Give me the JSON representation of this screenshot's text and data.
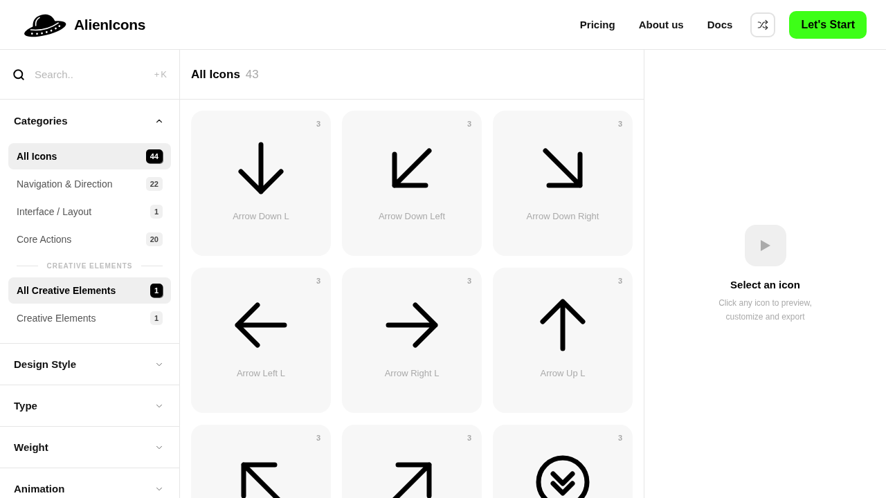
{
  "header": {
    "brand": "AlienIcons",
    "nav": [
      "Pricing",
      "About us",
      "Docs"
    ],
    "cta": "Let's Start"
  },
  "sidebar": {
    "search": {
      "placeholder": "Search..",
      "shortcut": "+K"
    },
    "sections": [
      {
        "title": "Categories",
        "expanded": true,
        "groups": [
          {
            "items": [
              {
                "label": "All Icons",
                "count": "44",
                "selected": true
              },
              {
                "label": "Navigation & Direction",
                "count": "22",
                "selected": false
              },
              {
                "label": "Interface / Layout",
                "count": "1",
                "selected": false
              },
              {
                "label": "Core Actions",
                "count": "20",
                "selected": false
              }
            ]
          },
          {
            "label": "CREATIVE ELEMENTS",
            "items": [
              {
                "label": "All Creative Elements",
                "count": "1",
                "selected": true
              },
              {
                "label": "Creative Elements",
                "count": "1",
                "selected": false
              }
            ]
          }
        ]
      },
      {
        "title": "Design Style",
        "expanded": false
      },
      {
        "title": "Type",
        "expanded": false
      },
      {
        "title": "Weight",
        "expanded": false
      },
      {
        "title": "Animation",
        "expanded": false
      }
    ]
  },
  "main": {
    "title": "All Icons",
    "count": "43",
    "cards": [
      {
        "kind": "down",
        "name": "Arrow Down L",
        "count": "3"
      },
      {
        "kind": "down-left",
        "name": "Arrow Down Left",
        "count": "3"
      },
      {
        "kind": "down-right",
        "name": "Arrow Down Right",
        "count": "3"
      },
      {
        "kind": "left",
        "name": "Arrow Left L",
        "count": "3"
      },
      {
        "kind": "right",
        "name": "Arrow Right L",
        "count": "3"
      },
      {
        "kind": "up",
        "name": "Arrow Up L",
        "count": "3"
      },
      {
        "kind": "up-left",
        "count": "3"
      },
      {
        "kind": "up-right",
        "count": "3"
      },
      {
        "kind": "chevrons-down-circle",
        "count": "3"
      }
    ]
  },
  "preview": {
    "title": "Select an icon",
    "hint": "Click any icon to preview, customize and export"
  }
}
